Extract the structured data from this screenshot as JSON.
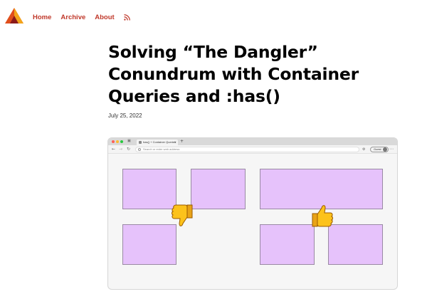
{
  "nav": {
    "items": [
      {
        "label": "Home"
      },
      {
        "label": "Archive"
      },
      {
        "label": "About"
      }
    ],
    "rss_icon": "rss-icon",
    "color": "#c0392b"
  },
  "logo": {
    "icon": "triangle-logo",
    "colors": [
      "#e04e1b",
      "#f3a41a",
      "#8b1a1a"
    ]
  },
  "article": {
    "title": "Solving “The Dangler” Conundrum with Container Queries and :has()",
    "date": "July 25, 2022"
  },
  "figure": {
    "browser": {
      "tab_title": "has() + Container Queries",
      "url_placeholder": "Search or enter web address",
      "profile_label": "Guest"
    },
    "box_color": "#e6c2fb",
    "left_group": {
      "reaction": "thumbs-down"
    },
    "right_group": {
      "reaction": "thumbs-up"
    }
  }
}
